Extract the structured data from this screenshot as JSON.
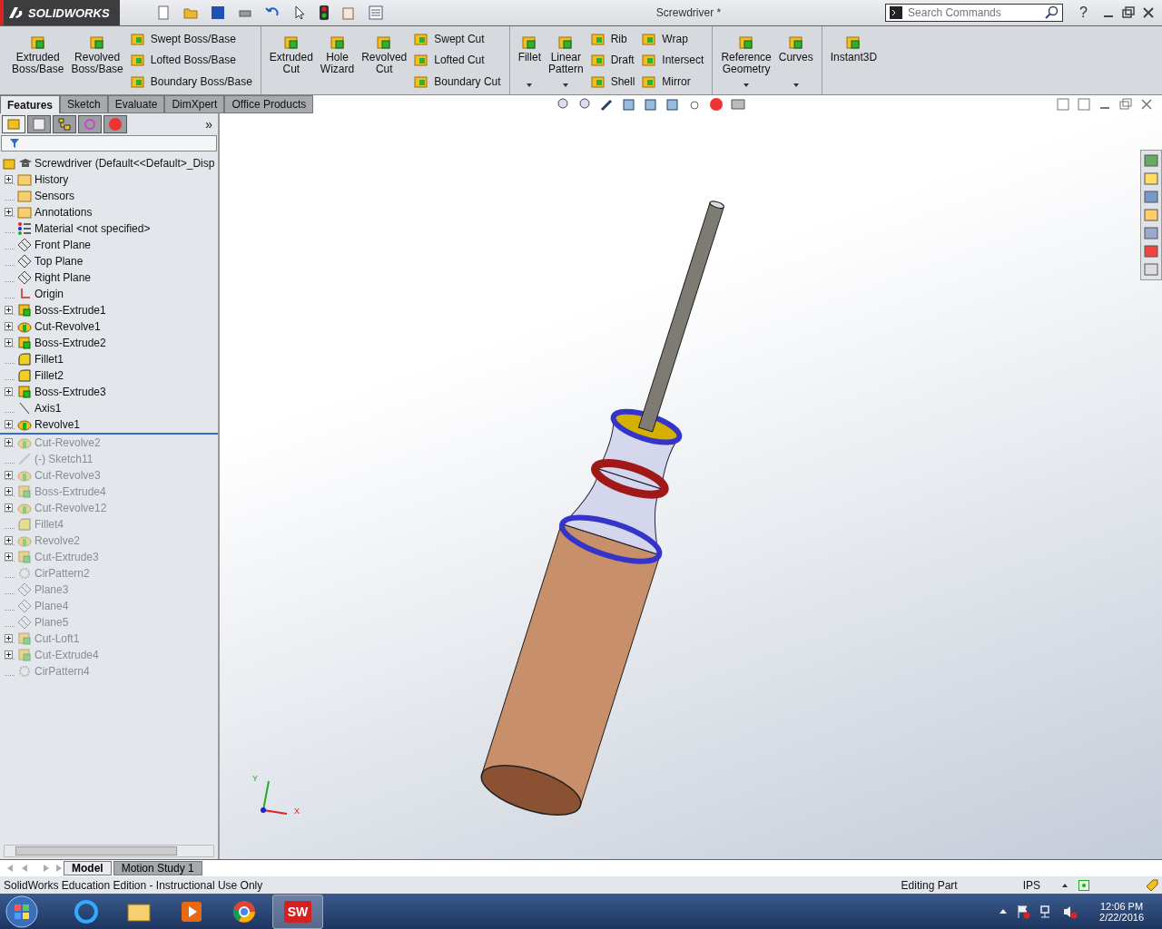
{
  "app": {
    "logo_text": "SOLIDWORKS",
    "title": "Screwdriver *",
    "search": {
      "placeholder": "Search Commands"
    },
    "help": "?"
  },
  "ribbon": [
    {
      "columns": [
        {
          "kind": "large",
          "label": "Extruded\nBoss/Base",
          "dropdown": false
        },
        {
          "kind": "large",
          "label": "Revolved\nBoss/Base",
          "dropdown": false
        },
        {
          "kind": "stack",
          "items": [
            "Swept Boss/Base",
            "Lofted Boss/Base",
            "Boundary Boss/Base"
          ]
        }
      ]
    },
    {
      "columns": [
        {
          "kind": "large",
          "label": "Extruded\nCut",
          "dropdown": false
        },
        {
          "kind": "large",
          "label": "Hole\nWizard",
          "dropdown": false
        },
        {
          "kind": "large",
          "label": "Revolved\nCut",
          "dropdown": false
        },
        {
          "kind": "stack",
          "items": [
            "Swept Cut",
            "Lofted Cut",
            "Boundary Cut"
          ]
        }
      ]
    },
    {
      "columns": [
        {
          "kind": "large",
          "label": "Fillet",
          "dropdown": true
        },
        {
          "kind": "large",
          "label": "Linear\nPattern",
          "dropdown": true
        },
        {
          "kind": "stack",
          "items": [
            "Rib",
            "Draft",
            "Shell"
          ]
        },
        {
          "kind": "stack",
          "items": [
            "Wrap",
            "Intersect",
            "Mirror"
          ]
        }
      ]
    },
    {
      "columns": [
        {
          "kind": "large",
          "label": "Reference\nGeometry",
          "dropdown": true
        },
        {
          "kind": "large",
          "label": "Curves",
          "dropdown": true
        }
      ]
    },
    {
      "columns": [
        {
          "kind": "large",
          "label": "Instant3D",
          "dropdown": false
        }
      ]
    }
  ],
  "command_tabs": [
    {
      "label": "Features",
      "selected": true
    },
    {
      "label": "Sketch",
      "selected": false
    },
    {
      "label": "Evaluate",
      "selected": false
    },
    {
      "label": "DimXpert",
      "selected": false
    },
    {
      "label": "Office Products",
      "selected": false
    }
  ],
  "panel_tabs": [
    {
      "kind": "tree",
      "selected": true
    },
    {
      "kind": "property",
      "selected": false
    },
    {
      "kind": "config",
      "selected": false
    },
    {
      "kind": "target",
      "selected": false
    },
    {
      "kind": "display",
      "selected": false
    }
  ],
  "panel_more": "»",
  "tree": {
    "root": "Screwdriver  (Default<<Default>_Disp",
    "items": [
      {
        "label": "History",
        "kind": "folder",
        "expandable": true,
        "rolled_back": false
      },
      {
        "label": "Sensors",
        "kind": "folder",
        "expandable": false,
        "rolled_back": false
      },
      {
        "label": "Annotations",
        "kind": "annotation",
        "expandable": true,
        "rolled_back": false
      },
      {
        "label": "Material <not specified>",
        "kind": "material",
        "expandable": false,
        "rolled_back": false
      },
      {
        "label": "Front Plane",
        "kind": "plane",
        "expandable": false,
        "rolled_back": false
      },
      {
        "label": "Top Plane",
        "kind": "plane",
        "expandable": false,
        "rolled_back": false
      },
      {
        "label": "Right Plane",
        "kind": "plane",
        "expandable": false,
        "rolled_back": false
      },
      {
        "label": "Origin",
        "kind": "origin",
        "expandable": false,
        "rolled_back": false
      },
      {
        "label": "Boss-Extrude1",
        "kind": "extrude",
        "expandable": true,
        "rolled_back": false
      },
      {
        "label": "Cut-Revolve1",
        "kind": "revolve",
        "expandable": true,
        "rolled_back": false
      },
      {
        "label": "Boss-Extrude2",
        "kind": "extrude",
        "expandable": true,
        "rolled_back": false
      },
      {
        "label": "Fillet1",
        "kind": "fillet",
        "expandable": false,
        "rolled_back": false
      },
      {
        "label": "Fillet2",
        "kind": "fillet",
        "expandable": false,
        "rolled_back": false
      },
      {
        "label": "Boss-Extrude3",
        "kind": "extrude",
        "expandable": true,
        "rolled_back": false
      },
      {
        "label": "Axis1",
        "kind": "axis",
        "expandable": false,
        "rolled_back": false
      },
      {
        "label": "Revolve1",
        "kind": "revolve",
        "expandable": true,
        "rolled_back": false
      },
      {
        "label": "Cut-Revolve2",
        "kind": "revolve",
        "expandable": true,
        "rolled_back": true
      },
      {
        "label": "(-) Sketch11",
        "kind": "sketch",
        "expandable": false,
        "rolled_back": true
      },
      {
        "label": "Cut-Revolve3",
        "kind": "revolve",
        "expandable": true,
        "rolled_back": true
      },
      {
        "label": "Boss-Extrude4",
        "kind": "extrude",
        "expandable": true,
        "rolled_back": true
      },
      {
        "label": "Cut-Revolve12",
        "kind": "revolve",
        "expandable": true,
        "rolled_back": true
      },
      {
        "label": "Fillet4",
        "kind": "fillet",
        "expandable": false,
        "rolled_back": true
      },
      {
        "label": "Revolve2",
        "kind": "revolve",
        "expandable": true,
        "rolled_back": true
      },
      {
        "label": "Cut-Extrude3",
        "kind": "extrude",
        "expandable": true,
        "rolled_back": true
      },
      {
        "label": "CirPattern2",
        "kind": "pattern",
        "expandable": false,
        "rolled_back": true
      },
      {
        "label": "Plane3",
        "kind": "plane",
        "expandable": false,
        "rolled_back": true
      },
      {
        "label": "Plane4",
        "kind": "plane",
        "expandable": false,
        "rolled_back": true
      },
      {
        "label": "Plane5",
        "kind": "plane",
        "expandable": false,
        "rolled_back": true
      },
      {
        "label": "Cut-Loft1",
        "kind": "extrude",
        "expandable": true,
        "rolled_back": true
      },
      {
        "label": "Cut-Extrude4",
        "kind": "extrude",
        "expandable": true,
        "rolled_back": true
      },
      {
        "label": "CirPattern4",
        "kind": "pattern",
        "expandable": false,
        "rolled_back": true
      }
    ]
  },
  "triad": {
    "y": "Y",
    "x": "X"
  },
  "bottom_tabs": [
    {
      "label": "Model",
      "selected": true
    },
    {
      "label": "Motion Study 1",
      "selected": false
    }
  ],
  "status_bar": {
    "message": "SolidWorks Education Edition - Instructional Use Only",
    "mode": "Editing Part",
    "units": "IPS"
  },
  "taskbar": {
    "apps": [
      {
        "kind": "browser",
        "active": false
      },
      {
        "kind": "folder",
        "active": false
      },
      {
        "kind": "media",
        "active": false
      },
      {
        "kind": "chrome",
        "active": false
      },
      {
        "kind": "sw",
        "active": true,
        "label": "SW"
      }
    ],
    "time": "12:06 PM",
    "date": "2/22/2016"
  }
}
